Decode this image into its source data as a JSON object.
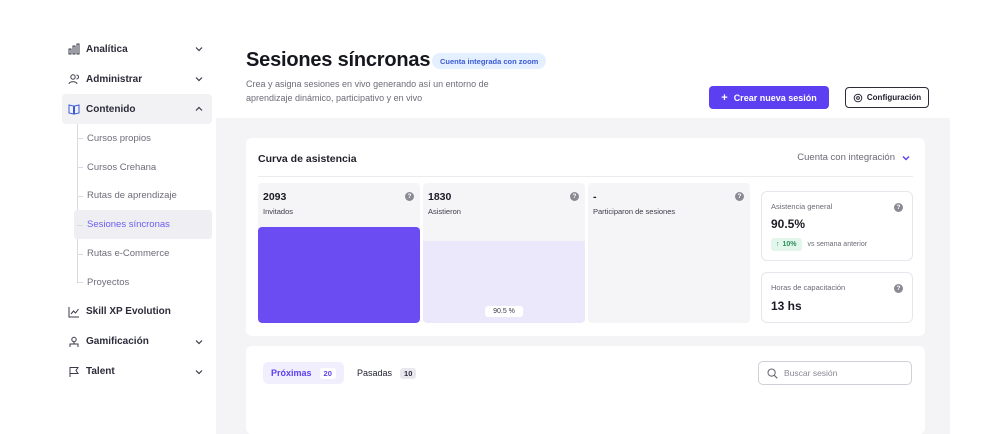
{
  "sidebar": {
    "items": [
      {
        "label": "Analítica",
        "icon": "bar-chart-icon"
      },
      {
        "label": "Administrar",
        "icon": "users-icon"
      },
      {
        "label": "Contenido",
        "icon": "book-icon"
      }
    ],
    "content_sub": [
      {
        "label": "Cursos propios"
      },
      {
        "label": "Cursos Crehana"
      },
      {
        "label": "Rutas de aprendizaje"
      },
      {
        "label": "Sesiones síncronas"
      },
      {
        "label": "Rutas e-Commerce"
      },
      {
        "label": "Proyectos"
      }
    ],
    "bottom_items": [
      {
        "label": "Skill XP Evolution",
        "icon": "skill-chart-icon"
      },
      {
        "label": "Gamificación",
        "icon": "trophy-icon"
      },
      {
        "label": "Talent",
        "icon": "flag-icon"
      }
    ]
  },
  "header": {
    "title": "Sesiones síncronas",
    "badge": "Cuenta integrada con zoom",
    "subtitle": "Crea y asigna sesiones en vivo generando así un entorno de aprendizaje dinámico, participativo y en vivo",
    "create_button": "Crear nueva sesión",
    "config_button": "Configuración"
  },
  "attendance": {
    "title": "Curva de asistencia",
    "filter": "Cuenta con integración",
    "stats": [
      {
        "value": "2093",
        "label": "Invitados",
        "fill": 1.0
      },
      {
        "value": "1830",
        "label": "Asistieron",
        "fill": 0.87,
        "pill": "90.5 %"
      },
      {
        "value": "-",
        "label": "Participaron de sesiones",
        "fill": 0
      }
    ],
    "general": {
      "label": "Asistencia general",
      "value": "90.5%",
      "trend": "10%",
      "trend_text": "vs semana anterior"
    },
    "hours": {
      "label": "Horas de capacitación",
      "value": "13 hs"
    }
  },
  "sessions": {
    "tabs": [
      {
        "label": "Próximas",
        "count": "20"
      },
      {
        "label": "Pasadas",
        "count": "10"
      }
    ],
    "search_placeholder": "Buscar sesión"
  },
  "colors": {
    "accent": "#5b3ff0",
    "bar_primary": "#6a4cf2",
    "bar_secondary": "#ece8fc",
    "trend_green": "#2a8f5c"
  }
}
